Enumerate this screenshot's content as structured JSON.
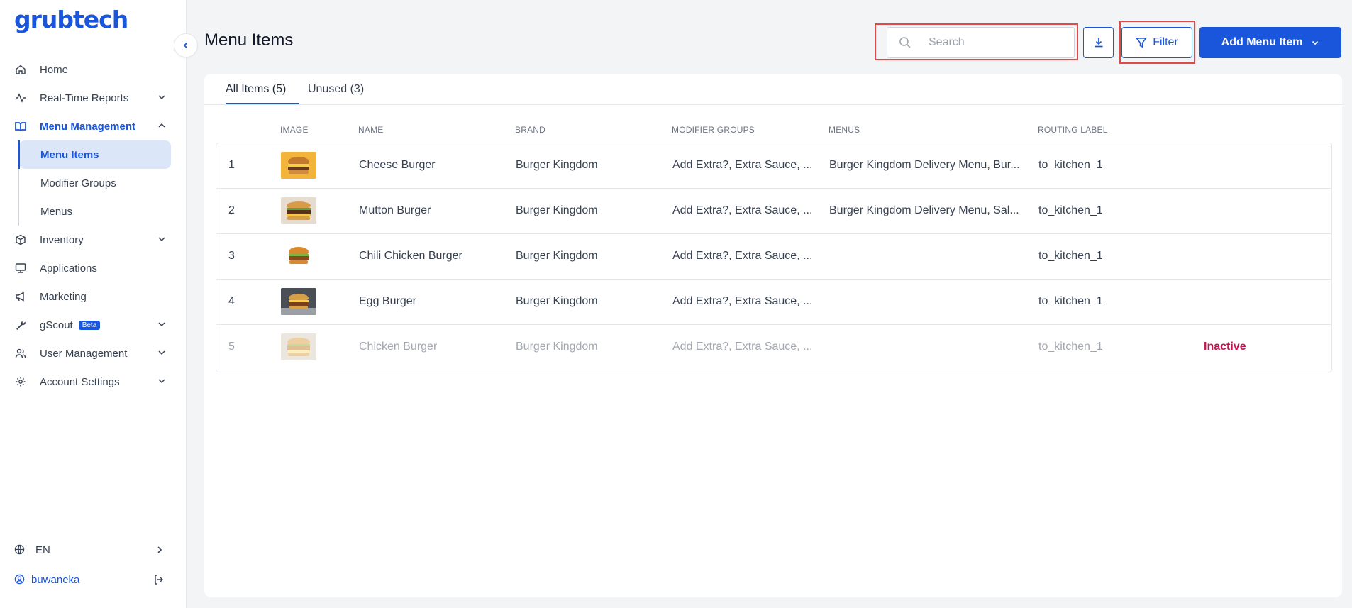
{
  "app": {
    "logo": "grubtech"
  },
  "sidebar": {
    "items": [
      {
        "label": "Home"
      },
      {
        "label": "Real-Time Reports"
      },
      {
        "label": "Menu Management"
      },
      {
        "label": "Inventory"
      },
      {
        "label": "Applications"
      },
      {
        "label": "Marketing"
      },
      {
        "label": "gScout",
        "badge": "Beta"
      },
      {
        "label": "User Management"
      },
      {
        "label": "Account Settings"
      }
    ],
    "sub_items": [
      {
        "label": "Menu Items"
      },
      {
        "label": "Modifier Groups"
      },
      {
        "label": "Menus"
      }
    ],
    "language": "EN",
    "user": "buwaneka"
  },
  "header": {
    "title": "Menu Items",
    "search_placeholder": "Search",
    "filter_label": "Filter",
    "add_label": "Add Menu Item"
  },
  "tabs": [
    {
      "label": "All Items (5)"
    },
    {
      "label": "Unused (3)"
    }
  ],
  "table": {
    "columns": [
      "IMAGE",
      "NAME",
      "BRAND",
      "MODIFIER GROUPS",
      "MENUS",
      "ROUTING LABEL"
    ],
    "rows": [
      {
        "index": "1",
        "name": "Cheese Burger",
        "brand": "Burger Kingdom",
        "modifiers": "Add Extra?, Extra Sauce, ...",
        "menus": "Burger Kingdom Delivery Menu, Bur...",
        "routing": "to_kitchen_1",
        "status": ""
      },
      {
        "index": "2",
        "name": "Mutton Burger",
        "brand": "Burger Kingdom",
        "modifiers": "Add Extra?, Extra Sauce, ...",
        "menus": "Burger Kingdom Delivery Menu, Sal...",
        "routing": "to_kitchen_1",
        "status": ""
      },
      {
        "index": "3",
        "name": "Chili Chicken Burger",
        "brand": "Burger Kingdom",
        "modifiers": "Add Extra?, Extra Sauce, ...",
        "menus": "",
        "routing": "to_kitchen_1",
        "status": ""
      },
      {
        "index": "4",
        "name": "Egg Burger",
        "brand": "Burger Kingdom",
        "modifiers": "Add Extra?, Extra Sauce, ...",
        "menus": "",
        "routing": "to_kitchen_1",
        "status": ""
      },
      {
        "index": "5",
        "name": "Chicken Burger",
        "brand": "Burger Kingdom",
        "modifiers": "Add Extra?, Extra Sauce, ...",
        "menus": "",
        "routing": "to_kitchen_1",
        "status": "Inactive"
      }
    ]
  },
  "colors": {
    "accent": "#1a56db",
    "highlight": "#e0484a",
    "inactive": "#c0184f"
  }
}
